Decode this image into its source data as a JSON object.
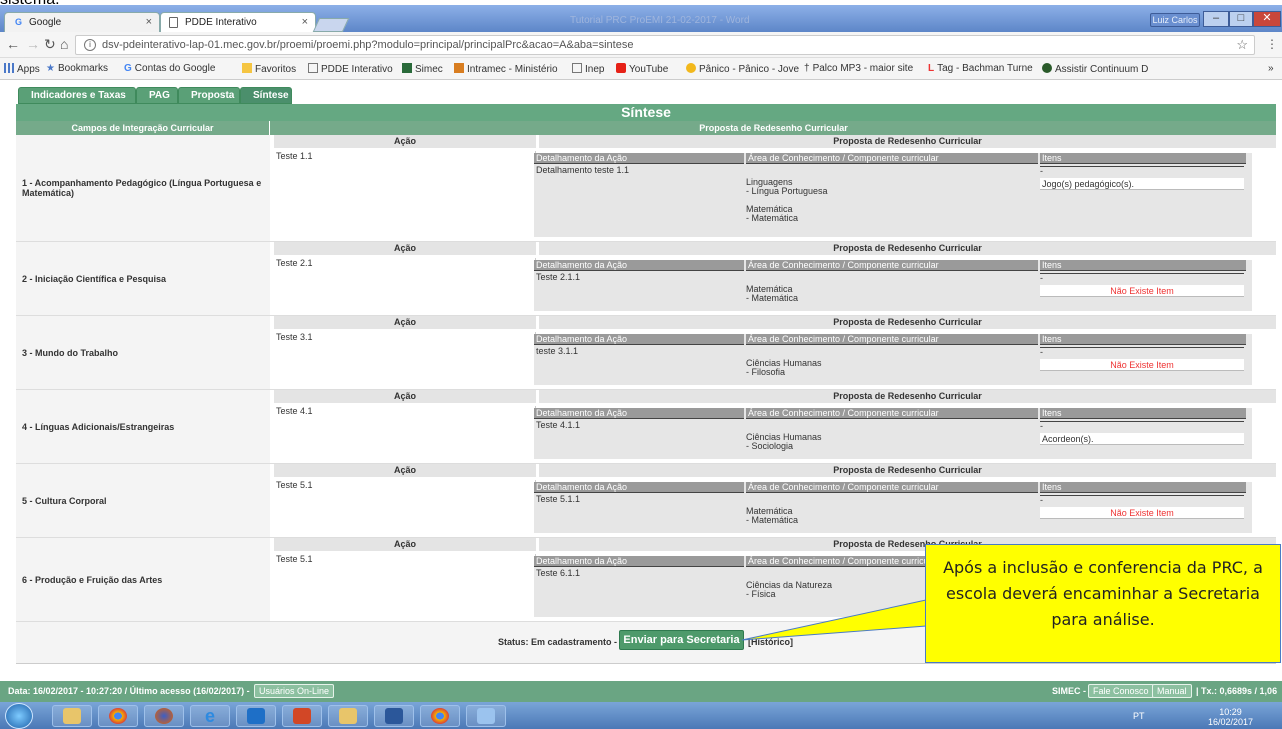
{
  "clipped_text": "sistema.",
  "browser": {
    "tabs": [
      {
        "label": "Google",
        "favicon": "G"
      },
      {
        "label": "PDDE Interativo",
        "favicon": "page"
      }
    ],
    "window_title": "Tutorial PRC ProEMI 21-02-2017 - Word",
    "user_button": "Luiz Carlos",
    "url": "dsv-pdeinterativo-lap-01.mec.gov.br/proemi/proemi.php?modulo=principal/principalPrc&acao=A&aba=sintese",
    "bookmarks": [
      "Apps",
      "Bookmarks",
      "Contas do Google",
      "Favoritos",
      "PDDE Interativo",
      "Simec",
      "Intramec - Ministério",
      "Inep",
      "YouTube",
      "Pânico - Pânico - Jove",
      "Palco MP3 - maior site",
      "Tag - Bachman Turne",
      "Assistir Continuum D"
    ]
  },
  "page": {
    "tabs": [
      "Indicadores e Taxas",
      "PAG",
      "Proposta",
      "Síntese"
    ],
    "section_title": "Síntese",
    "col_left": "Campos de Integração Curricular",
    "col_right": "Proposta de Redesenho Curricular",
    "acao_header": "Ação",
    "prop_header": "Proposta de Redesenho Curricular",
    "sub_headers": {
      "detalhamento": "Detalhamento da Ação",
      "area": "Área de Conhecimento / Componente curricular",
      "itens": "Itens"
    },
    "rows": [
      {
        "label": "1 - Acompanhamento Pedagógico (Língua Portuguesa e Matemática)",
        "acao": "Teste 1.1",
        "detalhe": "Detalhamento teste 1.1",
        "areas": [
          "Linguagens",
          " - Língua Portuguesa",
          "",
          "Matemática",
          " - Matemática"
        ],
        "item_dash": "-",
        "item": "Jogo(s) pedagógico(s).",
        "no_item": ""
      },
      {
        "label": "2 - Iniciação Científica e Pesquisa",
        "acao": "Teste 2.1",
        "detalhe": "Teste 2.1.1",
        "areas": [
          "Matemática",
          " - Matemática"
        ],
        "item_dash": "-",
        "item": "",
        "no_item": "Não Existe Item"
      },
      {
        "label": "3 - Mundo do Trabalho",
        "acao": "Teste 3.1",
        "detalhe": "teste 3.1.1",
        "areas": [
          "Ciências Humanas",
          " - Filosofia"
        ],
        "item_dash": "-",
        "item": "",
        "no_item": "Não Existe Item"
      },
      {
        "label": "4 - Línguas Adicionais/Estrangeiras",
        "acao": "Teste 4.1",
        "detalhe": "Teste 4.1.1",
        "areas": [
          "Ciências Humanas",
          " - Sociologia"
        ],
        "item_dash": "-",
        "item": "Acordeon(s).",
        "no_item": ""
      },
      {
        "label": "5 - Cultura Corporal",
        "acao": "Teste 5.1",
        "detalhe": "Teste 5.1.1",
        "areas": [
          "Matemática",
          " - Matemática"
        ],
        "item_dash": "-",
        "item": "",
        "no_item": "Não Existe Item"
      },
      {
        "label": "6 - Produção e Fruição das Artes",
        "acao": "Teste 5.1",
        "detalhe": "Teste 6.1.1",
        "areas": [
          "Ciências da Natureza",
          " - Física"
        ],
        "item_dash": "",
        "item": "",
        "no_item": ""
      }
    ],
    "status_text": "Status: Em cadastramento -",
    "send_button": "Enviar para Secretaria",
    "history_link": "[Histórico]",
    "callout": "Após a inclusão e conferencia da PRC, a escola deverá encaminhar a Secretaria para análise."
  },
  "footer": {
    "left": "Data: 16/02/2017 - 10:27:20 / Último acesso (16/02/2017) -",
    "online_users": "Usuários On-Line",
    "simec": "SIMEC -",
    "contact": "Fale Conosco",
    "manual": "Manual",
    "tx": "| Tx.: 0,6689s / 1,06"
  },
  "taskbar": {
    "lang": "PT",
    "time": "10:29",
    "date": "16/02/2017"
  }
}
